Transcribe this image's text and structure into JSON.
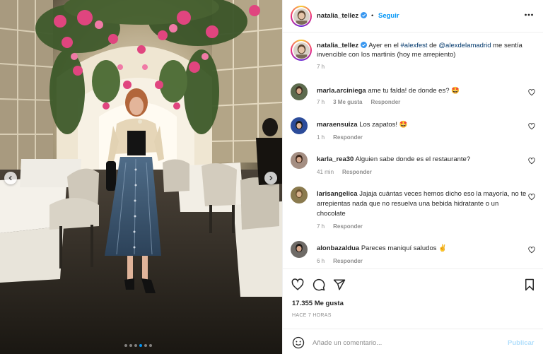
{
  "post": {
    "username": "natalia_tellez",
    "separator": "•",
    "follow_label": "Seguir",
    "caption_prefix": "Ayer en el ",
    "caption_hashtag": "#alexfest",
    "caption_mid": " de ",
    "caption_mention": "@alexdelamadrid",
    "caption_suffix": " me sentía invencible con los martinis (hoy me arrepiento)",
    "caption_time": "7 h",
    "likes": "17.355 Me gusta",
    "date": "HACE 7 HORAS"
  },
  "comments": [
    {
      "user": "marla.arciniega",
      "text": "ame tu falda! de donde es? 🤩",
      "time": "7 h",
      "likes": "3 Me gusta",
      "reply": "Responder"
    },
    {
      "user": "maraensuiza",
      "text": "Los zapatos! 🤩",
      "time": "1 h",
      "likes": "",
      "reply": "Responder"
    },
    {
      "user": "karla_rea30",
      "text": "Alguien sabe donde es el restaurante?",
      "time": "41 min",
      "likes": "",
      "reply": "Responder"
    },
    {
      "user": "larisangelica",
      "text": "Jajaja cuántas veces hemos dicho eso la mayoría, no te arrepientas nada que no resuelva una bebida hidratante o un chocolate",
      "time": "7 h",
      "likes": "",
      "reply": "Responder"
    },
    {
      "user": "alonbazaldua",
      "text": "Pareces maniquí saludos ✌️",
      "time": "6 h",
      "likes": "",
      "reply": "Responder"
    }
  ],
  "add_comment": {
    "placeholder": "Añade un comentario...",
    "publish_label": "Publicar"
  },
  "icons": [
    "more-options-icon",
    "verified-icon",
    "heart-icon",
    "comment-icon",
    "share-icon",
    "bookmark-icon",
    "emoji-icon",
    "chevron-left-icon",
    "chevron-right-icon"
  ],
  "carousel": {
    "total_slides": 6,
    "active_slide": 4
  },
  "colors": {
    "accent": "#0095f6",
    "text": "#262626",
    "muted": "#8e8e8e",
    "link": "#00376b",
    "publish_disabled": "#b2dffc"
  }
}
